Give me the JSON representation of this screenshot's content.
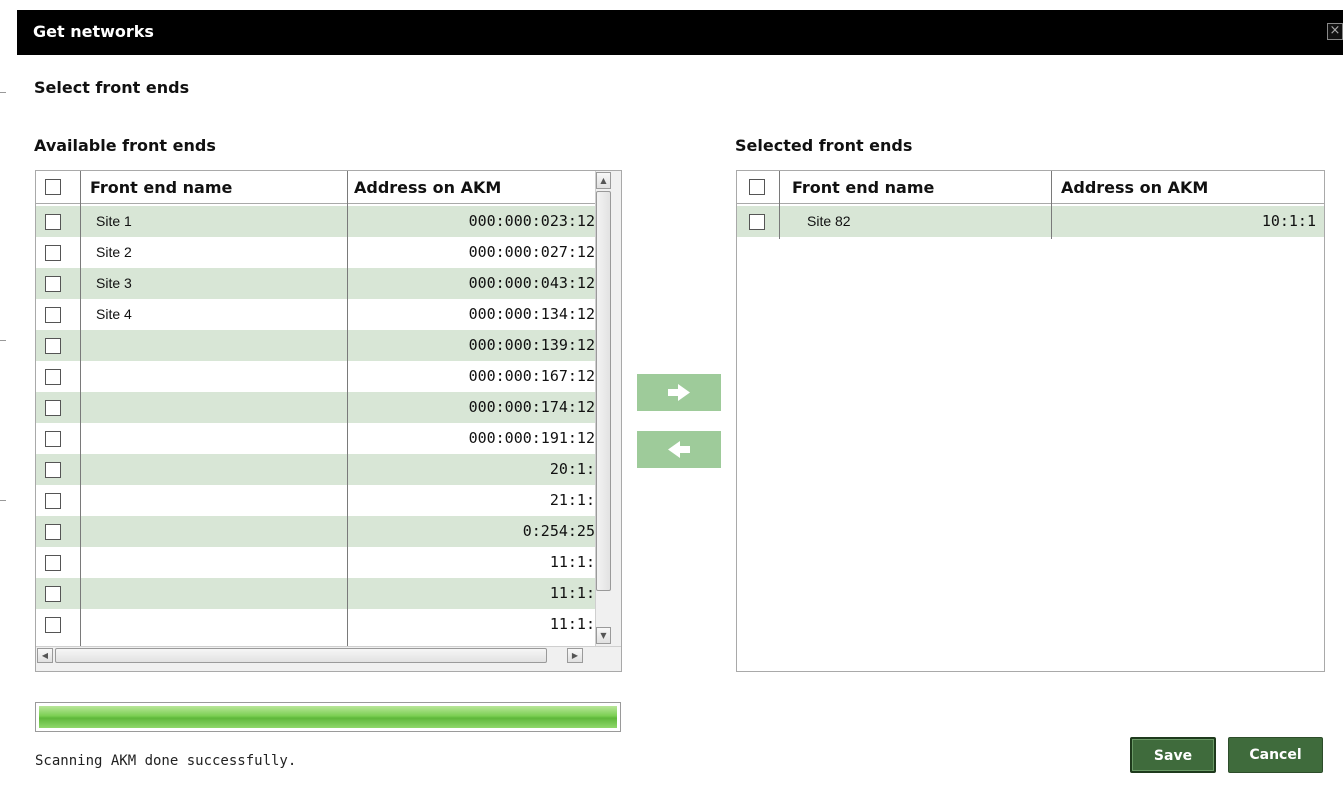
{
  "dialog": {
    "title": "Get networks",
    "close_glyph": "×",
    "section_title": "Select front ends"
  },
  "available": {
    "title": "Available front ends",
    "columns": {
      "name": "Front end name",
      "address": "Address on AKM"
    },
    "rows": [
      {
        "name": "Site 1",
        "address": "000:000:023:12"
      },
      {
        "name": "Site 2",
        "address": "000:000:027:12"
      },
      {
        "name": "Site 3",
        "address": "000:000:043:12"
      },
      {
        "name": "Site 4",
        "address": "000:000:134:12"
      },
      {
        "name": "",
        "address": "000:000:139:12"
      },
      {
        "name": "",
        "address": "000:000:167:12"
      },
      {
        "name": "",
        "address": "000:000:174:12"
      },
      {
        "name": "",
        "address": "000:000:191:12"
      },
      {
        "name": "",
        "address": "20:1:"
      },
      {
        "name": "",
        "address": "21:1:"
      },
      {
        "name": "",
        "address": "0:254:25"
      },
      {
        "name": "",
        "address": "11:1:"
      },
      {
        "name": "",
        "address": "11:1:"
      },
      {
        "name": "",
        "address": "11:1:"
      }
    ]
  },
  "selected": {
    "title": "Selected front ends",
    "columns": {
      "name": "Front end name",
      "address": "Address on AKM"
    },
    "rows": [
      {
        "name": "Site 82",
        "address": "10:1:1"
      }
    ]
  },
  "transfer": {
    "add_icon": "arrow-right-icon",
    "remove_icon": "arrow-left-icon",
    "color": "#9ecb9a"
  },
  "progress": {
    "value": 1.0,
    "color": "#6cc544"
  },
  "status_text": "Scanning AKM done successfully.",
  "buttons": {
    "save": "Save",
    "cancel": "Cancel",
    "color": "#3f6b3c"
  }
}
